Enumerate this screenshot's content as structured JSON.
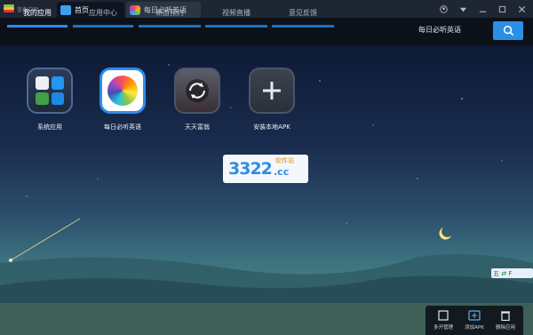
{
  "titlebar": {
    "brand": "蓝叠中国",
    "tabs": [
      {
        "label": "首页",
        "icon": "home-icon",
        "active": true
      },
      {
        "label": "每日必听英语",
        "icon": "photos-app-icon",
        "active": false
      }
    ],
    "window_icons": [
      "account-icon",
      "settings-icon",
      "minimize-icon",
      "maximize-icon",
      "close-icon"
    ]
  },
  "nav": {
    "items": [
      {
        "label": "我的应用",
        "active": true
      },
      {
        "label": "应用中心",
        "active": false
      },
      {
        "label": "新游预约",
        "active": false
      },
      {
        "label": "视频直播",
        "active": false
      },
      {
        "label": "意见反馈",
        "active": false
      }
    ],
    "search_value": "每日必听英语",
    "search_icon": "search-icon"
  },
  "apps": [
    {
      "label": "系统应用",
      "icon": "system-apps-icon"
    },
    {
      "label": "每日必听英语",
      "icon": "photos-app-icon"
    },
    {
      "label": "天天富翁",
      "icon": "refresh-app-icon"
    },
    {
      "label": "安装本地APK",
      "icon": "plus-icon"
    }
  ],
  "watermark": {
    "number": "3322",
    "suffix": ".cc",
    "site": "软件站"
  },
  "side_tag": {
    "text": "五 ⇄ F"
  },
  "dock": [
    {
      "label": "多开管理",
      "icon": "multi-instance-icon"
    },
    {
      "label": "添加APK",
      "icon": "add-apk-icon"
    },
    {
      "label": "删除应用",
      "icon": "trash-icon"
    }
  ],
  "colors": {
    "accent": "#2a8cf0",
    "nav_bg": "#0c1119",
    "titlebar_bg": "#1e2533"
  }
}
